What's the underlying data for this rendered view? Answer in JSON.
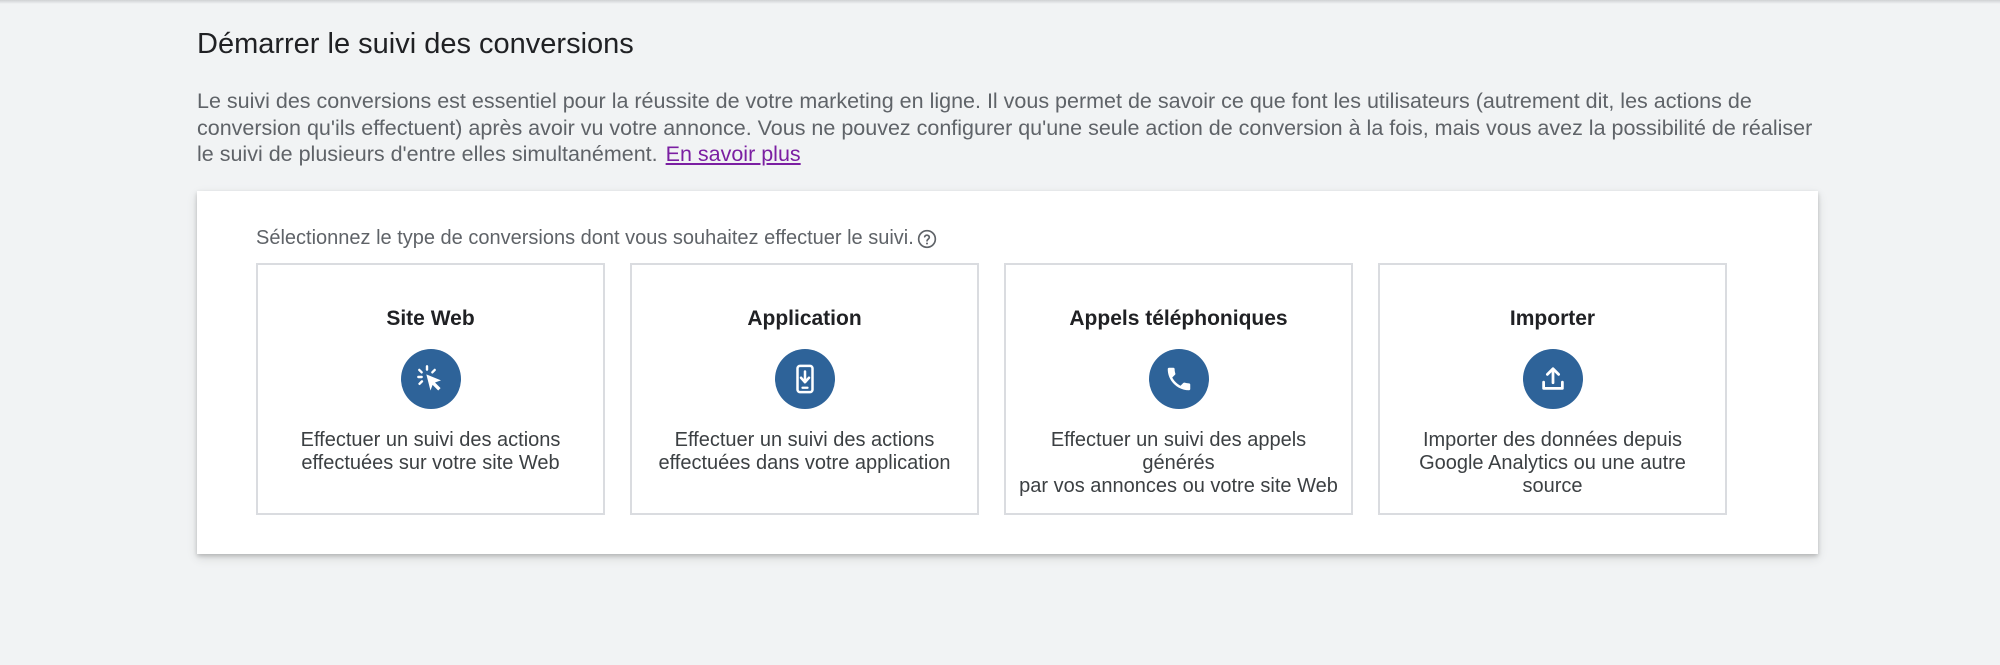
{
  "page": {
    "title": "Démarrer le suivi des conversions",
    "intro_text": "Le suivi des conversions est essentiel pour la réussite de votre marketing en ligne. Il vous permet de savoir ce que font les utilisateurs (autrement dit, les actions de conversion qu'ils effectuent) après avoir vu votre annonce. Vous ne pouvez configurer qu'une seule action de conversion à la fois, mais vous avez la possibilité de réaliser le suivi de plusieurs d'entre elles simultanément.",
    "learn_more_label": "En savoir plus"
  },
  "panel": {
    "label": "Sélectionnez le type de conversions dont vous souhaitez effectuer le suivi.",
    "help_icon": "help-circle-icon",
    "cards": [
      {
        "title": "Site Web",
        "icon": "cursor-click-icon",
        "desc_line1": "Effectuer un suivi des actions",
        "desc_line2": "effectuées sur votre site Web"
      },
      {
        "title": "Application",
        "icon": "mobile-download-icon",
        "desc_line1": "Effectuer un suivi des actions",
        "desc_line2": "effectuées dans votre application"
      },
      {
        "title": "Appels téléphoniques",
        "icon": "phone-icon",
        "desc_line1": "Effectuer un suivi des appels générés",
        "desc_line2": "par vos annonces ou votre site Web"
      },
      {
        "title": "Importer",
        "icon": "upload-icon",
        "desc_line1": "Importer des données depuis",
        "desc_line2": "Google Analytics ou une autre source"
      }
    ]
  },
  "colors": {
    "background": "#f1f3f4",
    "icon_circle": "#2e6399",
    "link": "#7b1fa2",
    "card_border": "#dadce0"
  }
}
